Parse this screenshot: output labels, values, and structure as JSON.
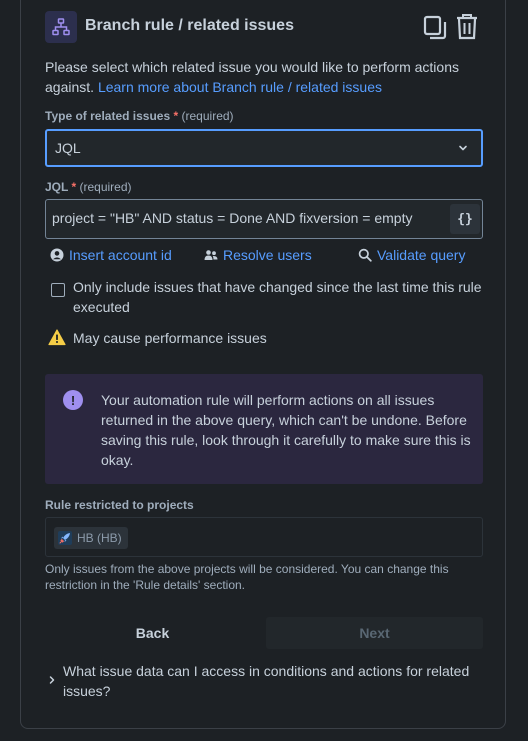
{
  "header": {
    "title": "Branch rule / related issues",
    "icons": [
      "branch-icon",
      "duplicate-icon",
      "trash-icon"
    ]
  },
  "description": {
    "text": "Please select which related issue you would like to perform actions against.",
    "link": "Learn more about Branch rule / related issues"
  },
  "type_field": {
    "label": "Type of related issues",
    "required_star": "*",
    "required_text": "(required)",
    "value": "JQL"
  },
  "jql_field": {
    "label": "JQL",
    "required_star": "*",
    "required_text": "(required)",
    "value": "project = \"HB\" AND status = Done AND fixversion = empty",
    "smart_values_button": "{}"
  },
  "actions": {
    "insert_account": "Insert account id",
    "resolve_users": "Resolve users",
    "validate_query": "Validate query"
  },
  "checkbox": {
    "label": "Only include issues that have changed since the last time this rule executed",
    "checked": false
  },
  "warning": {
    "text": "May cause performance issues"
  },
  "info": {
    "icon": "!",
    "text": "Your automation rule will perform actions on all issues returned in the above query, which can't be undone. Before saving this rule, look through it carefully to make sure this is okay."
  },
  "projects": {
    "label": "Rule restricted to projects",
    "tag": "HB (HB)",
    "hint": "Only issues from the above projects will be considered. You can change this restriction in the 'Rule details' section."
  },
  "buttons": {
    "back": "Back",
    "next": "Next"
  },
  "faq": {
    "text": "What issue data can I access in conditions and actions for related issues?"
  },
  "colors": {
    "background": "#1d2125",
    "link": "#579dff",
    "focus_border": "#579dff",
    "info_bg": "#2b273f",
    "info_icon": "#9f8fef",
    "warning": "#f5cd47",
    "required": "#f87168"
  }
}
